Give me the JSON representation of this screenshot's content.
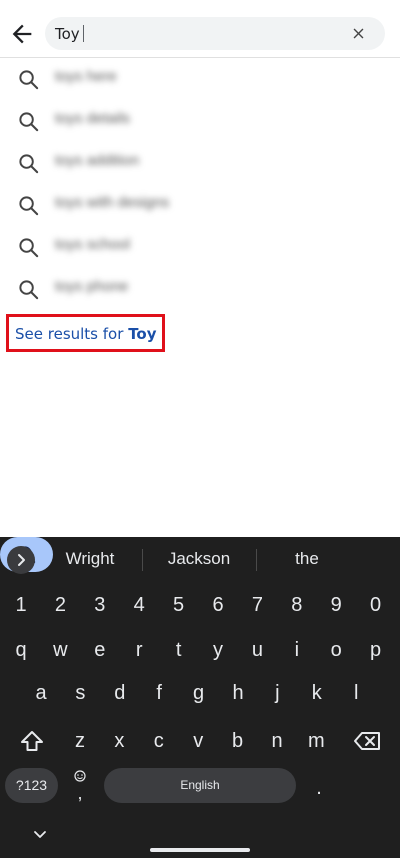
{
  "search": {
    "query": "Toy"
  },
  "suggestions": [
    {
      "text": "toys here"
    },
    {
      "text": "toys details"
    },
    {
      "text": "toys addition"
    },
    {
      "text": "toys with designs"
    },
    {
      "text": "toys school"
    },
    {
      "text": "toys phone"
    }
  ],
  "see_results": {
    "prefix": "See results for",
    "query": "Toy"
  },
  "keyboard": {
    "suggestions": [
      "Wright",
      "Jackson",
      "the"
    ],
    "row_numbers": [
      "1",
      "2",
      "3",
      "4",
      "5",
      "6",
      "7",
      "8",
      "9",
      "0"
    ],
    "row_1": [
      "q",
      "w",
      "e",
      "r",
      "t",
      "y",
      "u",
      "i",
      "o",
      "p"
    ],
    "row_2": [
      "a",
      "s",
      "d",
      "f",
      "g",
      "h",
      "j",
      "k",
      "l"
    ],
    "row_3": [
      "z",
      "x",
      "c",
      "v",
      "b",
      "n",
      "m"
    ],
    "symbols_label": "?123",
    "comma_label": ",",
    "period_label": ".",
    "space_label": "English"
  },
  "colors": {
    "highlight_border": "#e0101a",
    "link": "#1a4fa8",
    "keyboard_bg": "#1f1f1f",
    "search_key": "#a8c7fa"
  },
  "icons": {
    "back": "arrow-left-icon",
    "clear": "close-icon",
    "suggestion": "search-icon",
    "expand": "chevron-right-icon",
    "shift": "shift-icon",
    "backspace": "backspace-icon",
    "emoji": "emoji-icon",
    "search_action": "search-icon",
    "hide_keyboard": "chevron-down-icon"
  }
}
